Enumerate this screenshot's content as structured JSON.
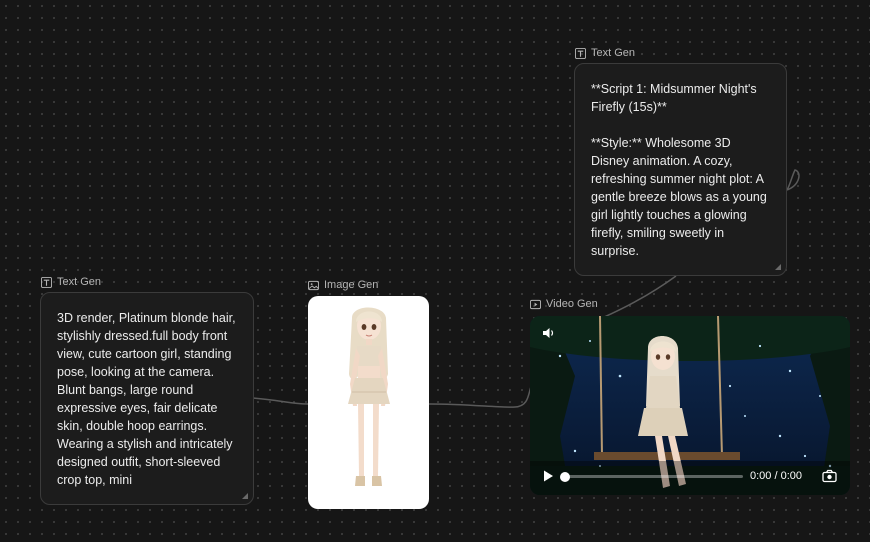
{
  "nodes": {
    "text_gen_left": {
      "label": "Text Gen",
      "content": "3D render, Platinum blonde hair, stylishly dressed.full body front view, cute cartoon girl, standing pose, looking at the camera. Blunt bangs, large round expressive eyes, fair delicate skin, double hoop earrings. Wearing a stylish and intricately designed outfit, short-sleeved crop top, mini"
    },
    "image_gen": {
      "label": "Image Gen"
    },
    "text_gen_right": {
      "label": "Text Gen",
      "content": "**Script 1: Midsummer Night's Firefly (15s)**\n\n**Style:** Wholesome 3D Disney animation. A cozy, refreshing summer night plot: A gentle breeze blows as a young girl lightly touches a glowing firefly, smiling sweetly in surprise."
    },
    "video_gen": {
      "label": "Video Gen",
      "time_display": "0:00 / 0:00",
      "progress": 0
    }
  },
  "icons": {
    "text_node": "text-t-icon",
    "image_node": "image-icon",
    "video_node": "video-play-icon",
    "volume": "volume-icon",
    "play": "play-icon",
    "screenshot": "camera-icon"
  },
  "colors": {
    "canvas": "#161616",
    "card": "#1c1c1c",
    "card_border": "#3b3b3b",
    "connector": "#5a5a5a"
  }
}
